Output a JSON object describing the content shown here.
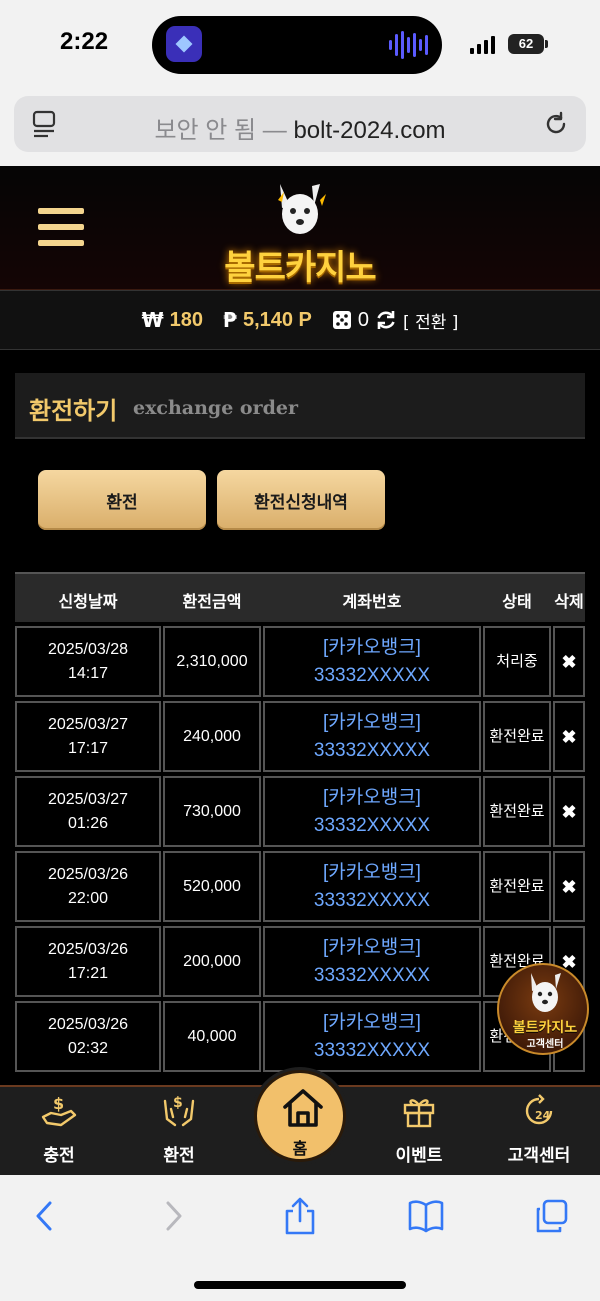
{
  "status_bar": {
    "time": "2:22",
    "battery": "62"
  },
  "url_bar": {
    "insecure_label": "보안 안 됨 —",
    "domain": "bolt-2024.com"
  },
  "header": {
    "logo_text": "볼트카지노"
  },
  "balance": {
    "won_symbol": "₩",
    "won_value": "180",
    "point_symbol": "₱",
    "point_value": "5,140 P",
    "dice_value": "0",
    "exchange_link": "[ 전환 ]"
  },
  "panel": {
    "title": "환전하기",
    "subtitle": "exchange order"
  },
  "buttons": {
    "exchange": "환전",
    "history": "환전신청내역"
  },
  "table": {
    "headers": {
      "date": "신청날짜",
      "amount": "환전금액",
      "account": "계좌번호",
      "status": "상태",
      "delete": "삭제"
    },
    "rows": [
      {
        "date": "2025/03/28",
        "time": "14:17",
        "amount": "2,310,000",
        "bank": "[카카오뱅크]",
        "acct": "33332XXXXX",
        "status": "처리중",
        "del": "✖"
      },
      {
        "date": "2025/03/27",
        "time": "17:17",
        "amount": "240,000",
        "bank": "[카카오뱅크]",
        "acct": "33332XXXXX",
        "status": "환전완료",
        "del": "✖"
      },
      {
        "date": "2025/03/27",
        "time": "01:26",
        "amount": "730,000",
        "bank": "[카카오뱅크]",
        "acct": "33332XXXXX",
        "status": "환전완료",
        "del": "✖"
      },
      {
        "date": "2025/03/26",
        "time": "22:00",
        "amount": "520,000",
        "bank": "[카카오뱅크]",
        "acct": "33332XXXXX",
        "status": "환전완료",
        "del": "✖"
      },
      {
        "date": "2025/03/26",
        "time": "17:21",
        "amount": "200,000",
        "bank": "[카카오뱅크]",
        "acct": "33332XXXXX",
        "status": "환전완료",
        "del": "✖"
      },
      {
        "date": "2025/03/26",
        "time": "02:32",
        "amount": "40,000",
        "bank": "[카카오뱅크]",
        "acct": "33332XXXXX",
        "status": "환전완료",
        "del": "✖"
      }
    ]
  },
  "float_cs": {
    "title": "볼트카지노",
    "sub": "고객센터"
  },
  "bottom_nav": {
    "charge": "충전",
    "exchange": "환전",
    "home": "홈",
    "event": "이벤트",
    "support": "고객센터"
  },
  "colors": {
    "gold": "#f2c96b",
    "link_blue": "#6ea8ff",
    "background": "#000000"
  }
}
